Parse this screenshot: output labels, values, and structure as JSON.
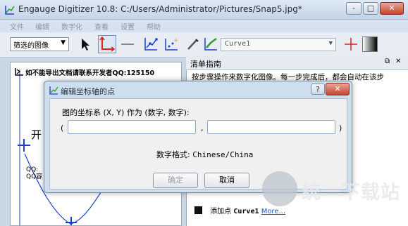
{
  "window": {
    "title": "Engauge Digitizer 10.8: C:/Users/Administrator/Pictures/Snap5.jpg*",
    "controls": [
      "-",
      "□",
      "✕"
    ]
  },
  "menu": [
    "文件",
    "编辑",
    "数字化",
    "查看",
    "设置",
    "帮助"
  ],
  "toolbar": {
    "filter_select": "筛选的图像",
    "curve_select": "Curve1",
    "tools": [
      "select-arrow-icon",
      "axis-point-icon",
      "scale-bar-icon",
      "point-match-icon",
      "color-picker-icon",
      "segment-fill-icon",
      "checklist-icon",
      "zoom-crosshair-icon",
      "gradient-swatch-icon"
    ]
  },
  "image_panel": {
    "caption": "如不能导出文档请联系开发者QQ:125150",
    "side_text_1": "开",
    "side_text_2": "QQ:\nQQ容"
  },
  "guide_panel": {
    "title": "清单指南",
    "text": "按步骤操作来数字化图像。每一步完成后，都会自动在该步",
    "step_prefix": "添加点",
    "step_curve": "Curve1",
    "step_link": "More..."
  },
  "dialog": {
    "title": "编辑坐标轴的点",
    "help": "?",
    "close": "✕",
    "coord_label": "图的坐标系 (X, Y) 作为 (数字, 数字):",
    "open_paren": "(",
    "comma": ",",
    "close_paren": ")",
    "x_value": "",
    "y_value": "",
    "format_label": "数字格式:",
    "format_value": "Chinese/China",
    "ok": "确定",
    "cancel": "取消"
  },
  "watermark": {
    "text": "统一下载站"
  },
  "colors": {
    "accent_red": "#d22",
    "axis_blue": "#1a3fd0",
    "dialog_frame": "#cfdeee"
  }
}
